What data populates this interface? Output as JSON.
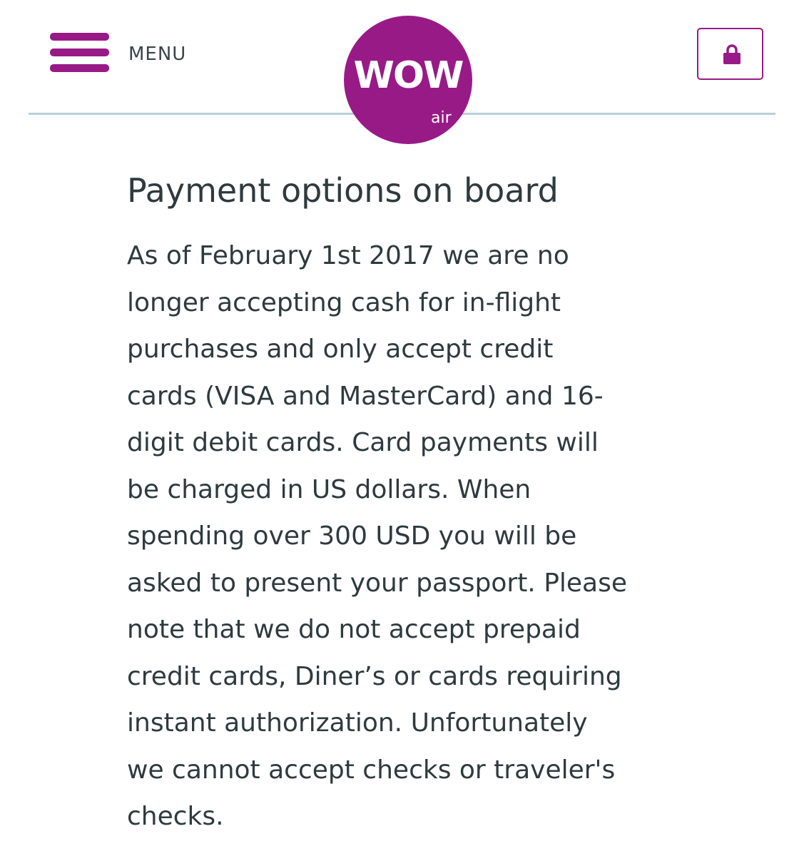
{
  "header": {
    "menu_label": "MENU",
    "logo": {
      "wordmark": "WOW",
      "sub": "air"
    }
  },
  "main": {
    "title": "Payment options on board",
    "body_lines": [
      "As of February 1st 2017 we are no",
      "longer accepting cash for in-flight",
      "purchases and only accept credit",
      "cards (VISA and MasterCard) and 16-",
      "digit debit cards. Card payments will",
      "be charged in US dollars. When",
      "spending over 300 USD you will be",
      "asked to present your passport. Please",
      "note that we do not accept prepaid",
      "credit cards, Diner’s or cards requiring",
      "instant authorization. Unfortunately",
      "we cannot accept checks or traveler's",
      "checks."
    ]
  },
  "icons": {
    "menu": "hamburger-icon",
    "lock": "lock-icon"
  },
  "colors": {
    "brand": "#981a87",
    "divider": "#b9cfd8",
    "text": "#2e3a3e"
  }
}
